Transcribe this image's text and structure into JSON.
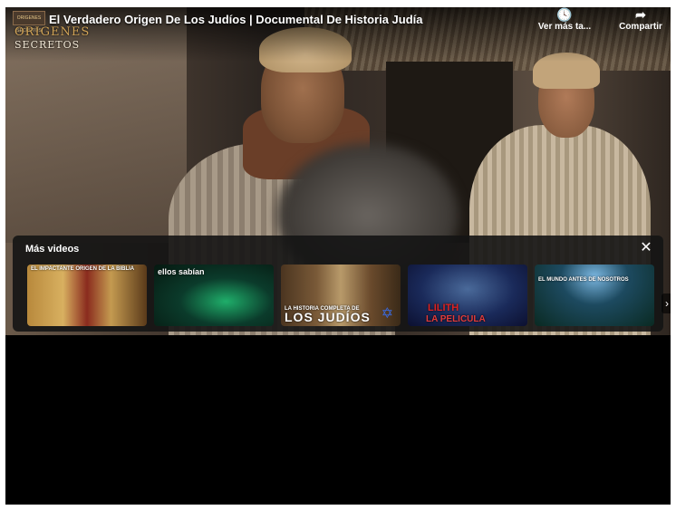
{
  "video": {
    "title": "El Verdadero Origen De Los Judíos | Documental De Historia Judía",
    "channel_badge": "ORIGENES SECRETOS",
    "logo_line1": "ORIGENES",
    "logo_line2": "SECRETOS"
  },
  "top_actions": {
    "watch_later_label": "Ver más ta...",
    "watch_later_icon": "clock-icon",
    "share_label": "Compartir",
    "share_icon": "share-arrow-icon"
  },
  "more_videos": {
    "title": "Más videos",
    "close_icon": "close-icon",
    "next_icon": "chevron-right-icon",
    "items": [
      {
        "caption": "EL IMPACTANTE ORIGEN DE LA BIBLIA"
      },
      {
        "caption": "ellos sabían"
      },
      {
        "caption_small": "LA HISTORIA COMPLETA DE",
        "caption_big": "LOS JUDÍOS"
      },
      {
        "caption_mid": "LILITH",
        "caption_low": "LA PELICULA"
      },
      {
        "caption": "EL MUNDO ANTES DE NOSOTROS"
      }
    ]
  }
}
